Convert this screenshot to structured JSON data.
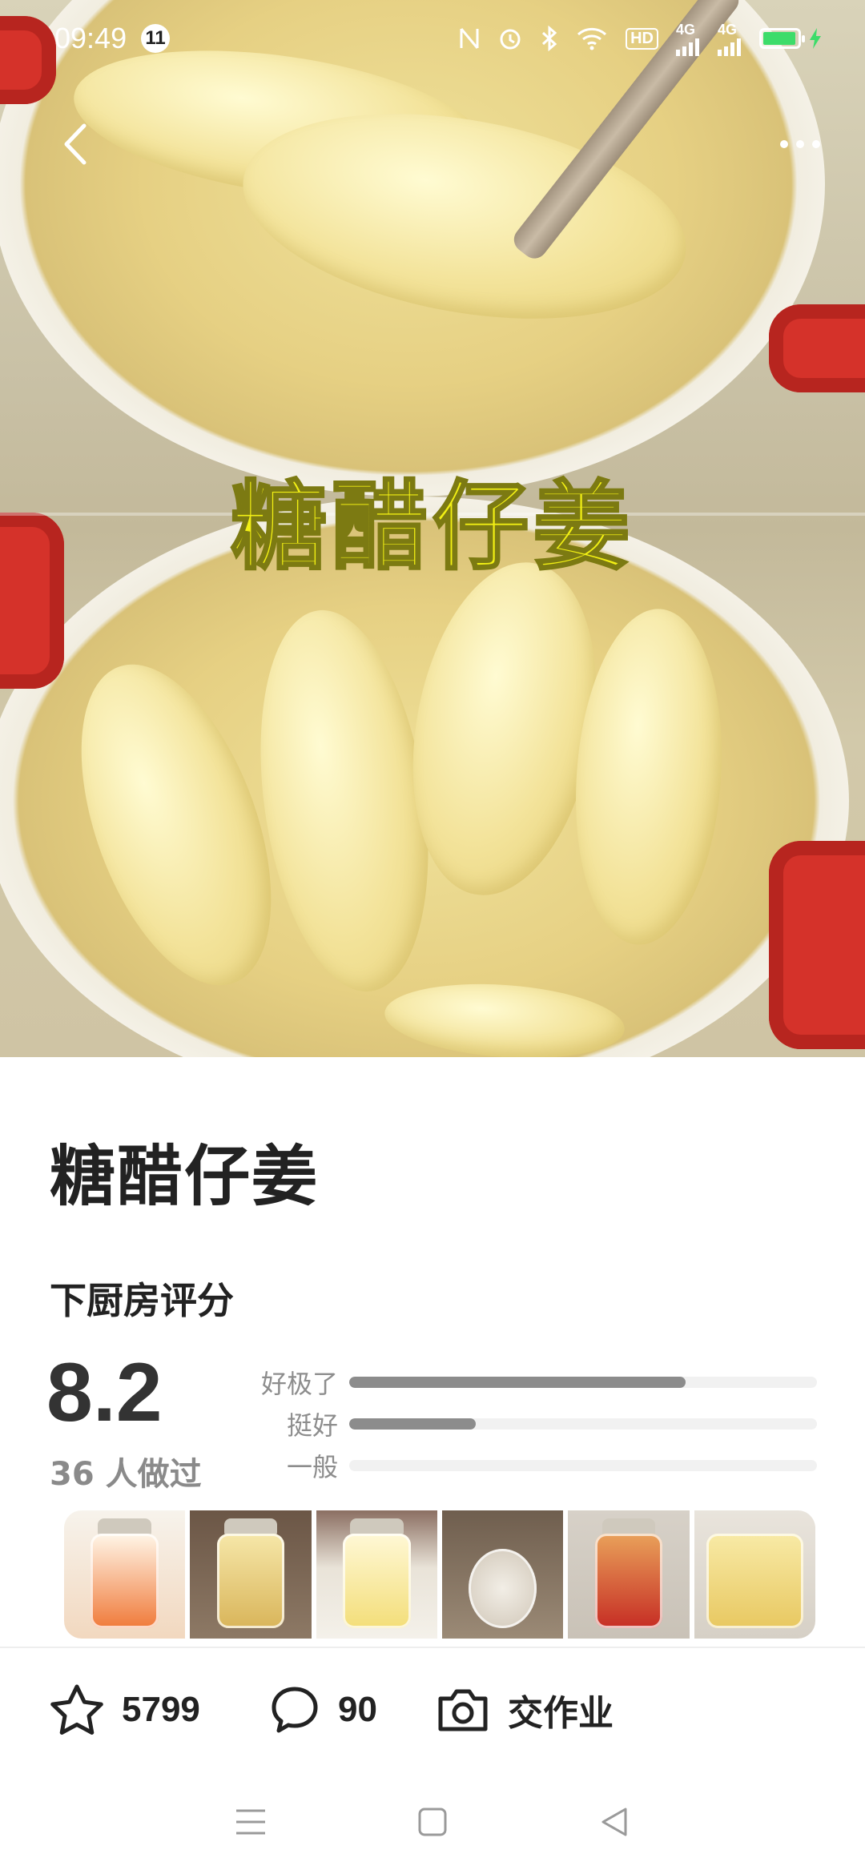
{
  "status_bar": {
    "time": "09:49",
    "notification_count": "11",
    "network_label_1": "4G",
    "network_label_2": "4G",
    "hd_label": "HD",
    "battery_color": "#3ddc6a"
  },
  "hero": {
    "overlay_title": "糖醋仔姜"
  },
  "recipe": {
    "title": "糖醋仔姜"
  },
  "rating": {
    "label": "下厨房评分",
    "score": "8.2",
    "cooked_text": "36 人做过",
    "bars": [
      {
        "label": "好极了",
        "fraction": 0.72
      },
      {
        "label": "挺好",
        "fraction": 0.27
      },
      {
        "label": "一般",
        "fraction": 0.0
      }
    ]
  },
  "thumbnails": [
    "t1",
    "t2",
    "t3",
    "t4",
    "t5",
    "t6"
  ],
  "actions": {
    "favorites_count": "5799",
    "comments_count": "90",
    "homework_label": "交作业"
  },
  "icons": {
    "back": "back-arrow-icon",
    "more": "more-dots-icon",
    "favorite": "star-icon",
    "comment": "chat-bubble-icon",
    "homework": "camera-icon"
  }
}
